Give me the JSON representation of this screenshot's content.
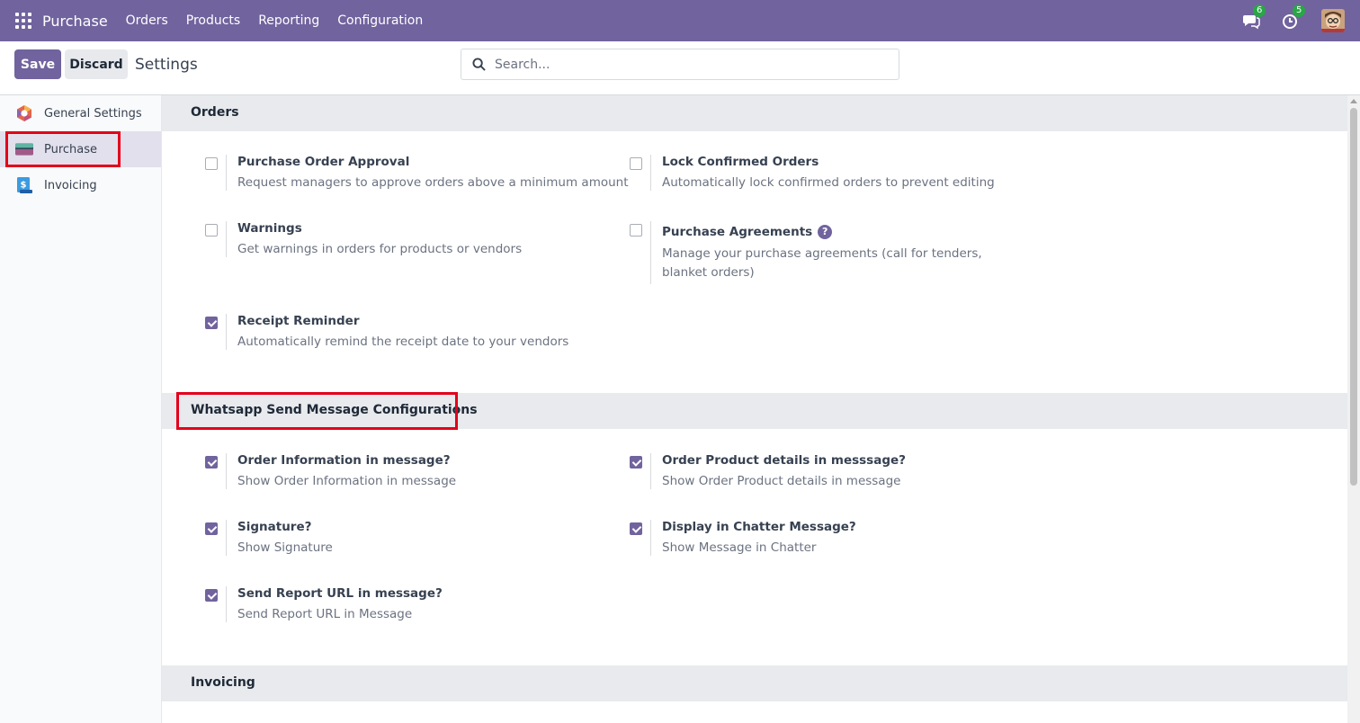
{
  "navbar": {
    "app_name": "Purchase",
    "menu": [
      "Orders",
      "Products",
      "Reporting",
      "Configuration"
    ],
    "messages_badge": "6",
    "activities_badge": "5",
    "icons": [
      "apps-grid-icon",
      "chat-icon",
      "clock-icon",
      "user-avatar"
    ]
  },
  "control_panel": {
    "save_label": "Save",
    "discard_label": "Discard",
    "breadcrumb": "Settings",
    "search_placeholder": "Search..."
  },
  "sidebar": {
    "items": [
      {
        "label": "General Settings",
        "icon": "odoo-logo-icon",
        "active": false
      },
      {
        "label": "Purchase",
        "icon": "purchase-app-icon",
        "active": true
      },
      {
        "label": "Invoicing",
        "icon": "invoicing-app-icon",
        "active": false
      }
    ]
  },
  "sections": {
    "orders": {
      "title": "Orders",
      "settings": [
        {
          "title": "Purchase Order Approval",
          "desc": "Request managers to approve orders above a minimum amount",
          "checked": false
        },
        {
          "title": "Lock Confirmed Orders",
          "desc": "Automatically lock confirmed orders to prevent editing",
          "checked": false
        },
        {
          "title": "Warnings",
          "desc": "Get warnings in orders for products or vendors",
          "checked": false
        },
        {
          "title": "Purchase Agreements",
          "desc": "Manage your purchase agreements (call for tenders, blanket orders)",
          "checked": false,
          "help": "?"
        },
        {
          "title": "Receipt Reminder",
          "desc": "Automatically remind the receipt date to your vendors",
          "checked": true
        }
      ]
    },
    "whatsapp": {
      "title": "Whatsapp Send Message Configurations",
      "settings": [
        {
          "title": "Order Information in message?",
          "desc": "Show Order Information in message",
          "checked": true
        },
        {
          "title": "Order Product details in messsage?",
          "desc": "Show Order Product details in message",
          "checked": true
        },
        {
          "title": "Signature?",
          "desc": "Show Signature",
          "checked": true
        },
        {
          "title": "Display in Chatter Message?",
          "desc": "Show Message in Chatter",
          "checked": true
        },
        {
          "title": "Send Report URL in message?",
          "desc": "Send Report URL in Message",
          "checked": true
        }
      ]
    },
    "invoicing": {
      "title": "Invoicing"
    }
  },
  "colors": {
    "brand": "#71639e",
    "highlight": "#e3001b",
    "badge": "#28a745"
  }
}
